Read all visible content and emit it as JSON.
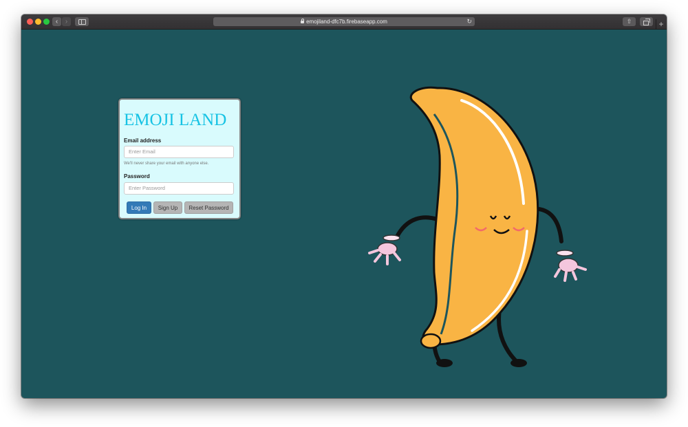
{
  "browser": {
    "url": "emojiland-dfc7b.firebaseapp.com",
    "back_glyph": "‹",
    "forward_glyph": "›",
    "reload_glyph": "↻",
    "share_glyph": "⇧",
    "newtab_glyph": "+",
    "background_color": "#1d555c"
  },
  "login": {
    "title": "EMOJI LAND",
    "email_label": "Email address",
    "email_placeholder": "Enter Email",
    "email_help": "We'll never share your email with anyone else.",
    "password_label": "Password",
    "password_placeholder": "Enter Password",
    "login_button": "Log In",
    "signup_button": "Sign Up",
    "reset_button": "Reset Password",
    "title_color": "#17c3e4",
    "login_button_color": "#337ab7"
  },
  "illustration": {
    "name": "dancing-banana-illustration",
    "banana_color": "#f9b444"
  }
}
